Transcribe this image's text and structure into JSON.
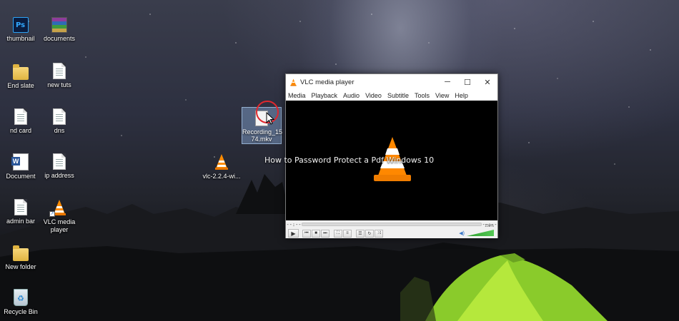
{
  "desktop": {
    "icons": [
      {
        "label": "thumbnail",
        "icon": "photoshop-icon"
      },
      {
        "label": "documents",
        "icon": "winrar-archive-icon"
      },
      {
        "label": "End slate",
        "icon": "folder-icon"
      },
      {
        "label": "new tuts",
        "icon": "document-icon"
      },
      {
        "label": "nd card",
        "icon": "document-icon"
      },
      {
        "label": "dns",
        "icon": "document-icon"
      },
      {
        "label": "Document",
        "icon": "word-document-icon"
      },
      {
        "label": "ip address",
        "icon": "document-icon"
      },
      {
        "label": "admin bar",
        "icon": "document-icon"
      },
      {
        "label": "VLC media player",
        "icon": "vlc-cone-icon"
      },
      {
        "label": "New folder",
        "icon": "folder-icon"
      },
      {
        "label": "Recycle Bin",
        "icon": "recycle-bin-icon"
      },
      {
        "label": "vlc-2.2.4-wi...",
        "icon": "vlc-installer-icon"
      }
    ],
    "selected_file": {
      "label": "Recording_1574.mkv",
      "label_line1": "Recording_15",
      "label_line2": "74.mkv",
      "icon": "video-file-icon"
    }
  },
  "overlay": {
    "text": "How to Password Protect a Pdf Windows 10"
  },
  "vlc": {
    "title": "VLC media player",
    "menu": [
      "Media",
      "Playback",
      "Audio",
      "Video",
      "Subtitle",
      "Tools",
      "View",
      "Help"
    ],
    "time_elapsed": "--:--",
    "time_total": "--:--",
    "volume_percent": "100%",
    "volume_level": 1.0,
    "colors": {
      "accent": "#ff8800",
      "volume": "#3fb43f"
    }
  }
}
